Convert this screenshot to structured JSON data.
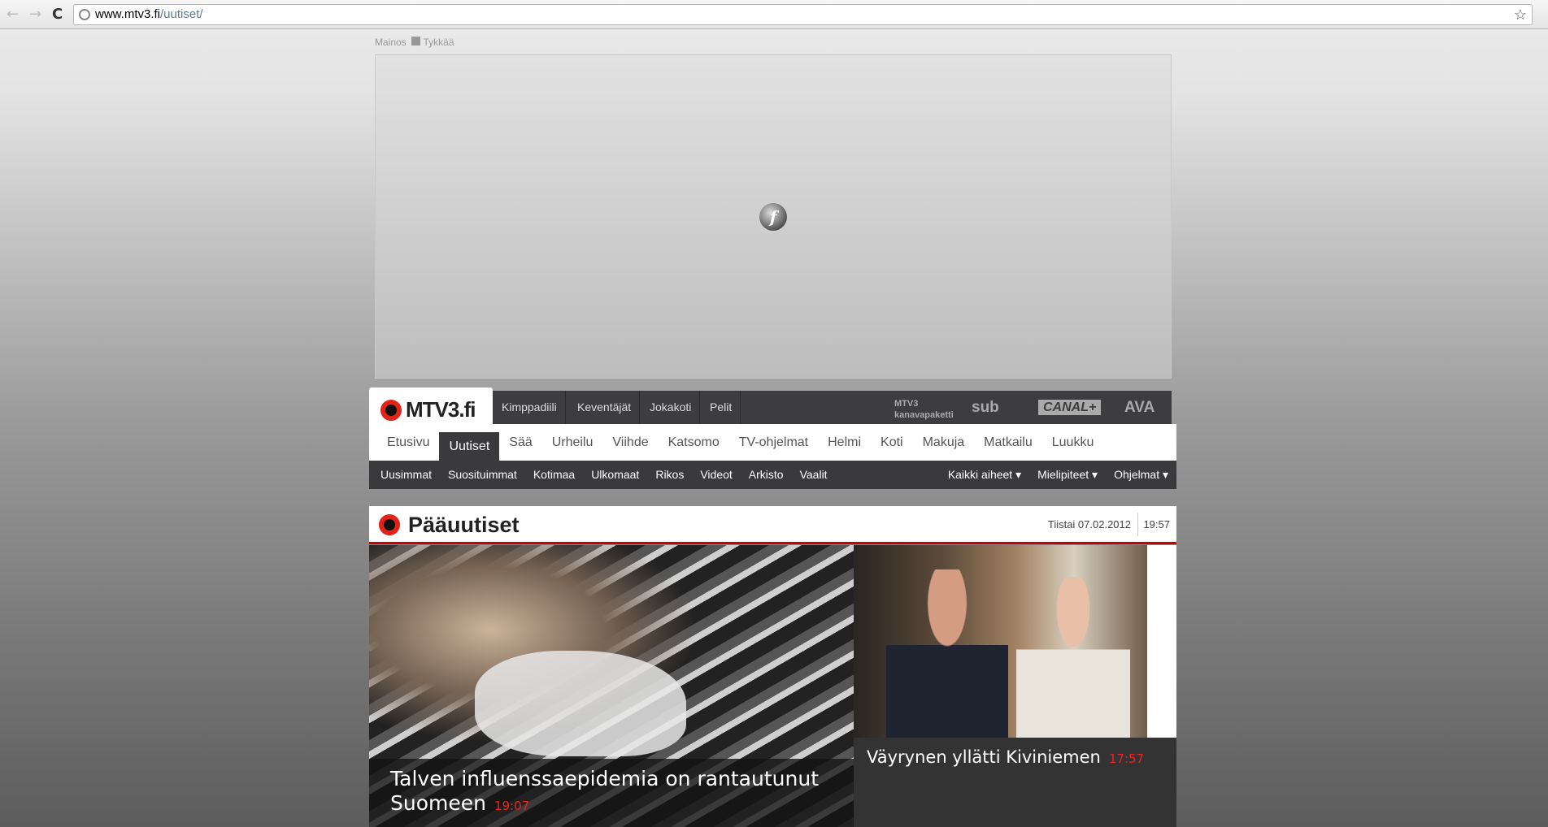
{
  "browser": {
    "url_host": "www.mtv3.fi",
    "url_path": "/uutiset/",
    "back": "←",
    "forward": "→",
    "reload": "C",
    "star": "☆"
  },
  "ad": {
    "label": "Mainos",
    "like": "Tykkää",
    "flash_glyph": "f"
  },
  "topbar": {
    "logo": "MTV3.fi",
    "links": [
      "Kimppadiili",
      "Keventäjät",
      "Jokakoti",
      "Pelit"
    ],
    "channels": [
      "MTV3 kanavapaketti",
      "sub",
      "CANAL+",
      "AVA"
    ]
  },
  "mainnav": {
    "items": [
      "Etusivu",
      "Uutiset",
      "Sää",
      "Urheilu",
      "Viihde",
      "Katsomo",
      "TV-ohjelmat",
      "Helmi",
      "Koti",
      "Makuja",
      "Matkailu",
      "Luukku"
    ],
    "active": "Uutiset"
  },
  "subnav": {
    "items": [
      "Uusimmat",
      "Suosituimmat",
      "Kotimaa",
      "Ulkomaat",
      "Rikos",
      "Videot",
      "Arkisto",
      "Vaalit"
    ],
    "dropdowns": [
      "Kaikki aiheet ▾",
      "Mielipiteet ▾",
      "Ohjelmat ▾"
    ]
  },
  "section": {
    "title": "Pääuutiset",
    "date": "Tiistai 07.02.2012",
    "time": "19:57"
  },
  "stories": [
    {
      "title": "Talven influenssaepidemia on rantautunut Suomeen",
      "time": "19:07"
    },
    {
      "title": "Väyrynen yllätti Kiviniemen",
      "time": "17:57"
    }
  ]
}
